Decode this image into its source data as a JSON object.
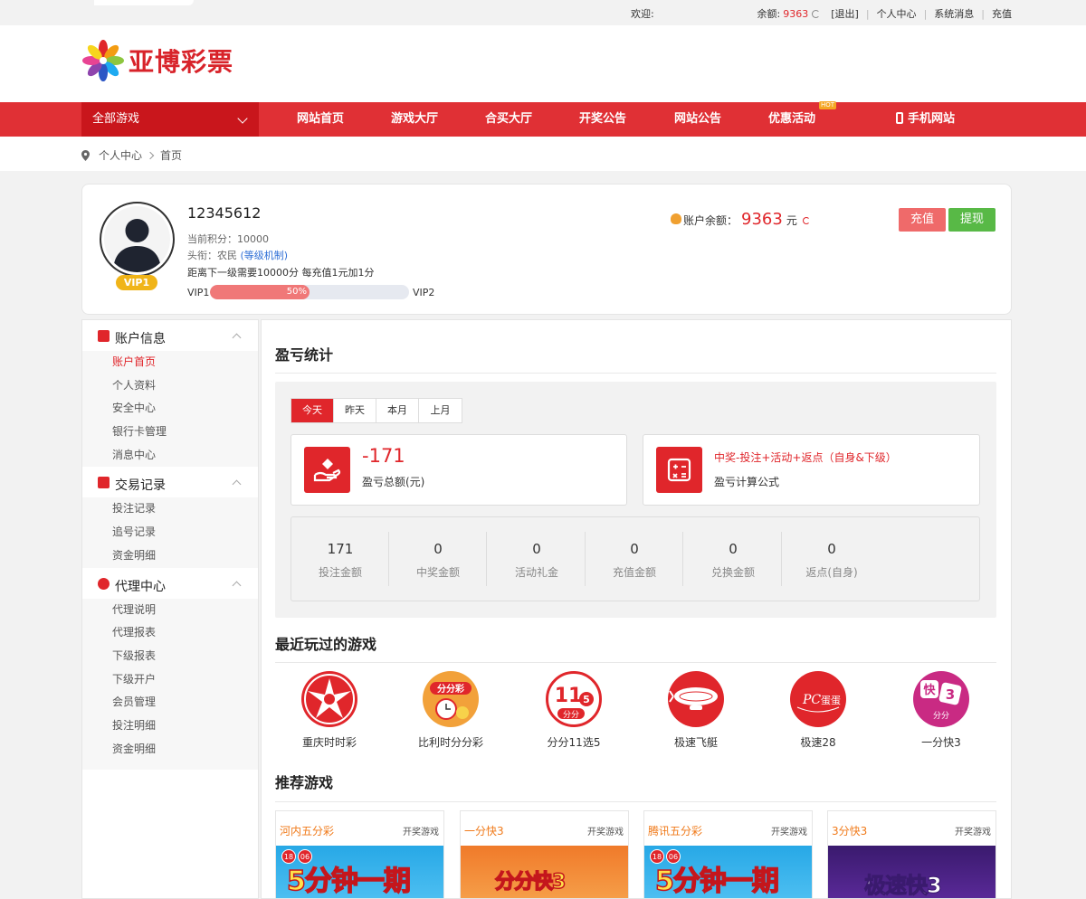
{
  "topbar": {
    "welcome": "欢迎:",
    "balance_label": "余额:",
    "balance_value": "9363",
    "logout": "[退出]",
    "center": "个人中心",
    "messages": "系统消息",
    "recharge": "充值"
  },
  "brand": {
    "name": "亚博彩票",
    "colors": {
      "primary": "#e03035",
      "dark": "#c9161c"
    }
  },
  "nav": {
    "all_games": "全部游戏",
    "items": [
      "网站首页",
      "游戏大厅",
      "合买大厅",
      "开奖公告",
      "网站公告",
      "优惠活动",
      "手机网站"
    ],
    "hot": "HOT"
  },
  "breadcrumb": {
    "items": [
      "个人中心",
      "首页"
    ]
  },
  "profile": {
    "username": "12345612",
    "points": "当前积分：10000",
    "title_prefix": "头衔：农民",
    "title_link": "(等级机制)",
    "next_level": "距离下一级需要10000分 每充值1元加1分",
    "vip_badge": "VIP1",
    "level_from": "VIP1",
    "level_to": "VIP2",
    "progress_label": "50%",
    "progress": 0.5,
    "balance_label": "账户余额：",
    "balance": "9363",
    "balance_unit": "元",
    "btn_recharge": "充值",
    "btn_withdraw": "提现"
  },
  "sidebar": {
    "groups": [
      {
        "title": "账户信息",
        "items": [
          "账户首页",
          "个人资料",
          "安全中心",
          "银行卡管理",
          "消息中心"
        ]
      },
      {
        "title": "交易记录",
        "items": [
          "投注记录",
          "追号记录",
          "资金明细"
        ]
      },
      {
        "title": "代理中心",
        "items": [
          "代理说明",
          "代理报表",
          "下级报表",
          "下级开户",
          "会员管理",
          "投注明细",
          "资金明细"
        ]
      }
    ]
  },
  "stats": {
    "title": "盈亏统计",
    "tabs": [
      "今天",
      "昨天",
      "本月",
      "上月"
    ],
    "profit_value": "-171",
    "profit_label": "盈亏总额(元)",
    "formula": "中奖-投注+活动+返点（自身&下级）",
    "formula_label": "盈亏计算公式",
    "figures": [
      {
        "value": "171",
        "label": "投注金额"
      },
      {
        "value": "0",
        "label": "中奖金额"
      },
      {
        "value": "0",
        "label": "活动礼金"
      },
      {
        "value": "0",
        "label": "充值金额"
      },
      {
        "value": "0",
        "label": "兑换金额"
      },
      {
        "value": "0",
        "label": "返点(自身)"
      }
    ]
  },
  "recent": {
    "title": "最近玩过的游戏",
    "games": [
      "重庆时时彩",
      "比利时分分彩",
      "分分11选5",
      "极速飞艇",
      "极速28",
      "一分快3"
    ]
  },
  "recommend": {
    "title": "推荐游戏",
    "link": "开奖游戏",
    "cards": [
      {
        "name": "河内五分彩",
        "banner": "5分钟一期"
      },
      {
        "name": "一分快3",
        "banner": "分分快3"
      },
      {
        "name": "腾讯五分彩",
        "banner": "5分钟一期"
      },
      {
        "name": "3分快3",
        "banner": "极速快3"
      }
    ]
  }
}
